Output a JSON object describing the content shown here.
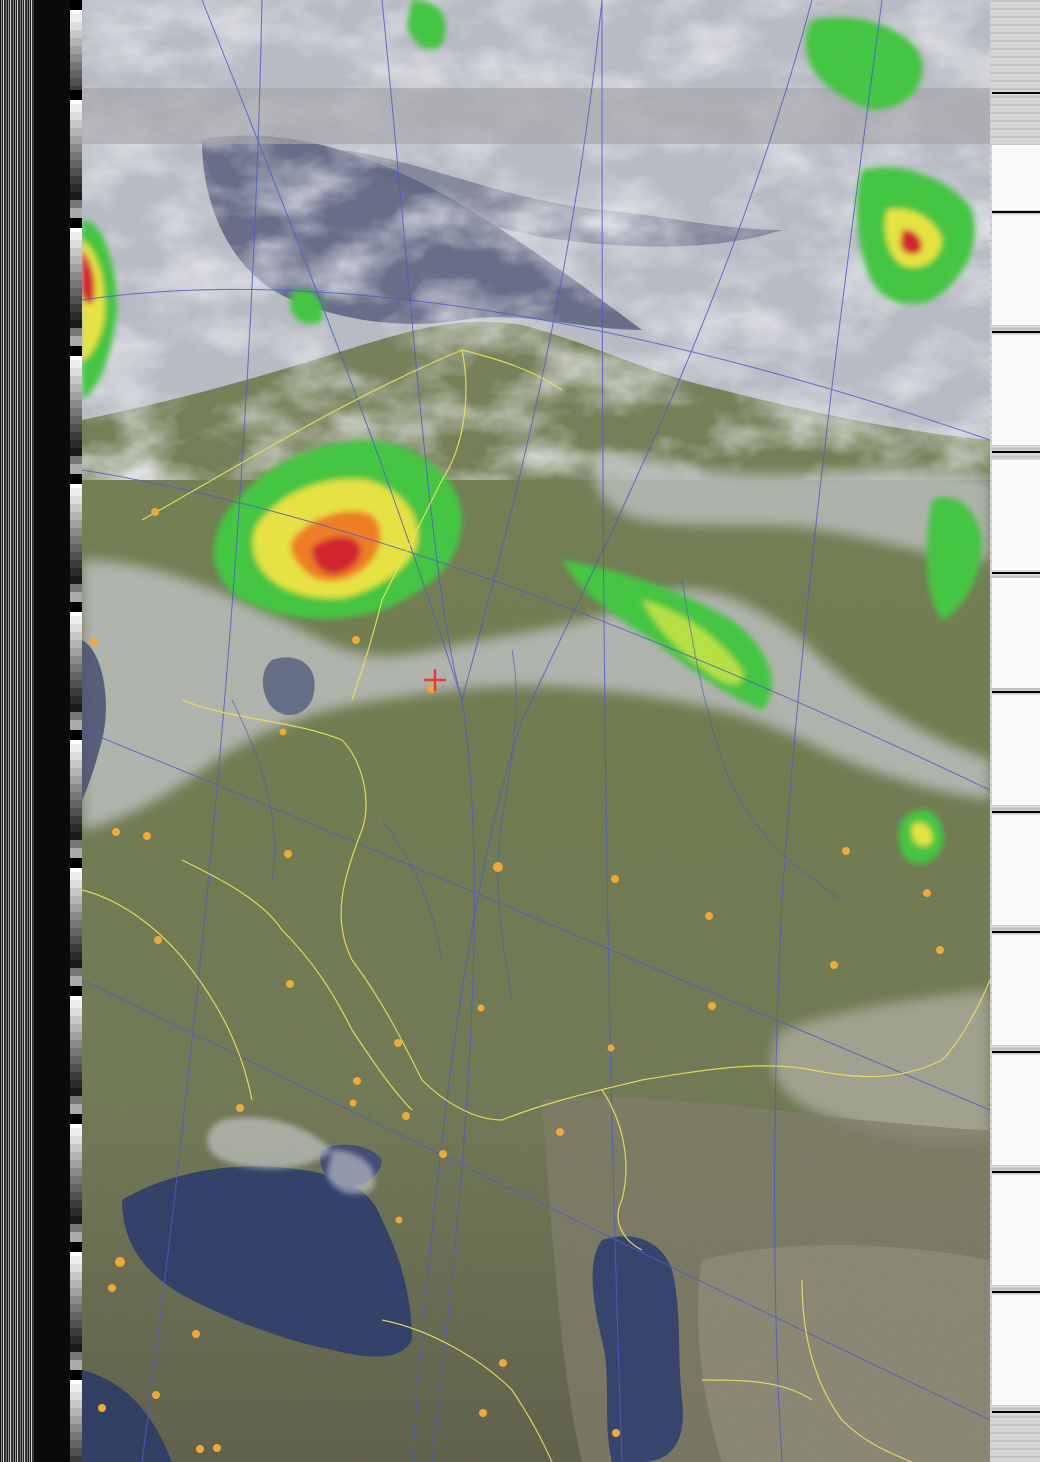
{
  "image": {
    "kind": "NOAA APT satellite image, false-colour with precipitation overlay",
    "palette": {
      "ocean": "#2c3a64",
      "land": "#6f7a52",
      "cloud": "#c9cbd3",
      "rain_light": "#4ad13f",
      "rain_mid": "#e8e63a",
      "rain_heavy": "#d0202a",
      "border": "#f0e650",
      "graticule": "#4a55c8",
      "city_dot": "#f4a82a",
      "marker": "#ff2a2a"
    },
    "overlay": {
      "cities": 38,
      "marker": "red-crosshair"
    }
  }
}
